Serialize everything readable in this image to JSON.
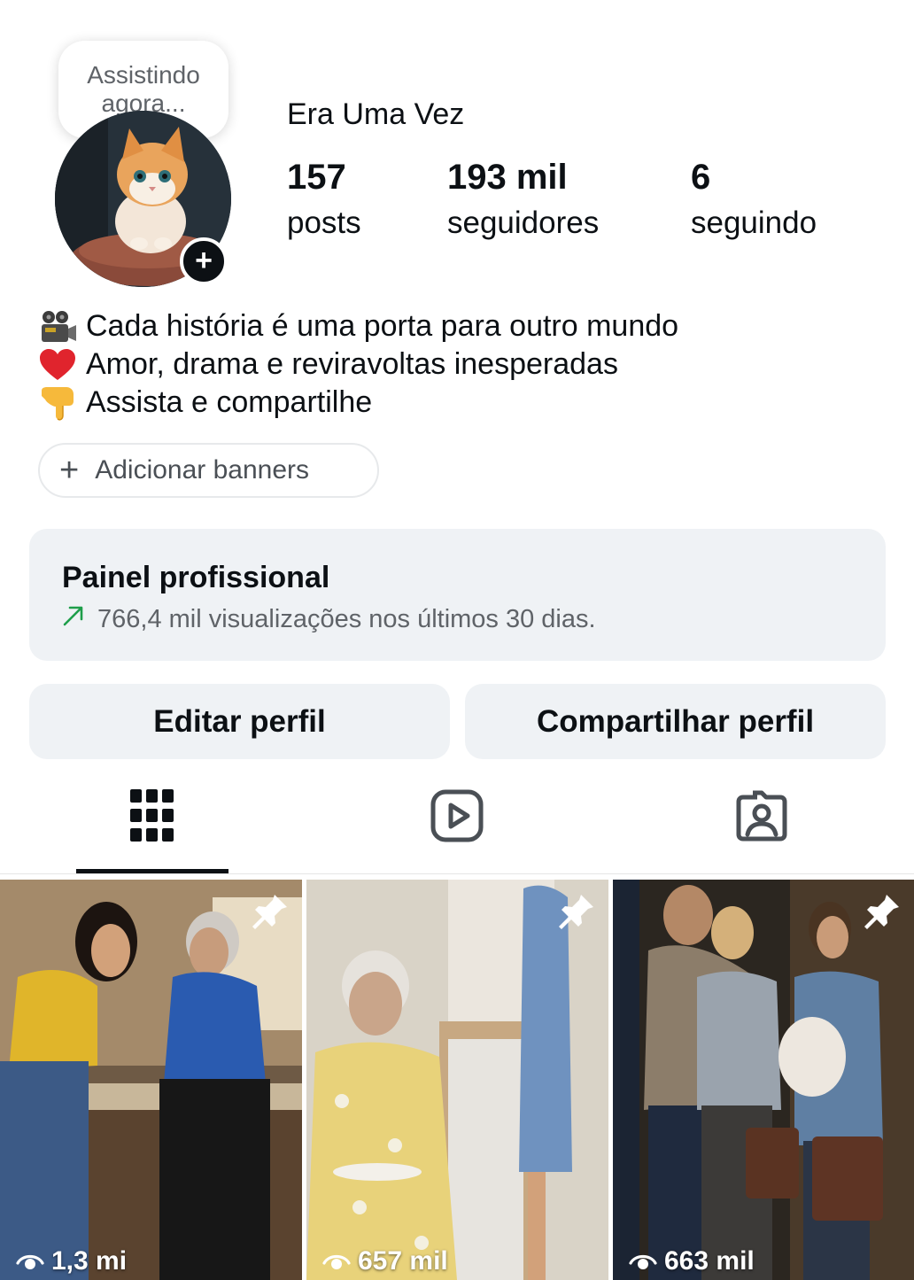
{
  "note": {
    "text": "Assistindo agora..."
  },
  "profile": {
    "name": "Era Uma Vez",
    "stats": [
      {
        "value": "157",
        "label": "posts"
      },
      {
        "value": "193 mil",
        "label": "seguidores"
      },
      {
        "value": "6",
        "label": "seguindo"
      }
    ]
  },
  "bio": {
    "lines": [
      {
        "icon": "film-projector-icon",
        "text": "Cada história é uma porta para outro mundo"
      },
      {
        "icon": "red-heart-icon",
        "text": "Amor, drama e reviravoltas inesperadas"
      },
      {
        "icon": "pointing-down-hand-icon",
        "text": "Assista e compartilhe"
      }
    ]
  },
  "banner_button": {
    "label": "Adicionar banners"
  },
  "professional_panel": {
    "title": "Painel profissional",
    "subtitle": "766,4 mil visualizações nos últimos 30 dias."
  },
  "actions": {
    "edit_label": "Editar perfil",
    "share_label": "Compartilhar perfil"
  },
  "tabs": [
    {
      "icon": "grid-icon",
      "selected": true
    },
    {
      "icon": "reels-icon",
      "selected": false
    },
    {
      "icon": "tagged-icon",
      "selected": false
    }
  ],
  "posts": [
    {
      "views": "1,3 mi",
      "pinned": true
    },
    {
      "views": "657 mil",
      "pinned": true
    },
    {
      "views": "663 mil",
      "pinned": true
    }
  ],
  "colors": {
    "text": "#0c1014",
    "panel_bg": "#eff2f5",
    "trend_green": "#1e9e4a",
    "heart_red": "#e0242d"
  }
}
